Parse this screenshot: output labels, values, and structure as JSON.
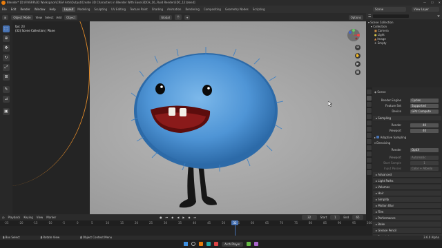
{
  "title_bar": {
    "text": "Blender* [D:\\FIVERR\\3D Workspace\\CREA Arts\\Output\\Create 3D Characters in Blender With Ease\\3DCH_16_Fluid Render\\3DC_12.blend]"
  },
  "menu": {
    "items": [
      "File",
      "Edit",
      "Render",
      "Window",
      "Help"
    ],
    "workspaces": [
      "Layout",
      "Modeling",
      "Sculpting",
      "UV Editing",
      "Texture Paint",
      "Shading",
      "Animation",
      "Rendering",
      "Compositing",
      "Geometry Nodes",
      "Scripting"
    ],
    "active_workspace": "Layout",
    "scene": "Scene",
    "view_layer": "View Layer"
  },
  "viewport_header": {
    "mode": "Object Mode",
    "menus": [
      "View",
      "Select",
      "Add",
      "Object"
    ],
    "transform": "Global",
    "options": "Options"
  },
  "viewport_info": {
    "fps": "fps: 23",
    "collection": "(32) Scene Collection | Plane"
  },
  "outliner": {
    "root": "Scene Collection",
    "items": [
      {
        "name": "Collection"
      },
      {
        "name": "Camera"
      },
      {
        "name": "Light"
      },
      {
        "name": "Image"
      },
      {
        "name": "Empty"
      }
    ]
  },
  "properties": {
    "scene_name": "Scene",
    "render_engine_label": "Render Engine",
    "render_engine": "Cycles",
    "feature_set_label": "Feature Set",
    "feature_set": "Supported",
    "device_label": "Device",
    "device": "GPU Compute",
    "sampling_label": "Sampling",
    "render_label": "Render",
    "render_samples": "40",
    "viewport_label": "Viewport",
    "viewport_samples": "40",
    "adaptive_label": "Adaptive Sampling",
    "denoising_label": "Denoising",
    "denoise_render_label": "Render",
    "denoiser": "OptiX",
    "denoise_viewport_label": "Viewport",
    "viewport_denoiser": "Automatic",
    "start_sample_label": "Start Sample",
    "start_sample": "1",
    "input_passes_label": "Input Passes",
    "input_passes": "Color + Albedo",
    "sections": [
      "Advanced",
      "Light Paths",
      "Volumes",
      "Hair",
      "Simplify",
      "Motion Blur",
      "Film",
      "Performance",
      "Bake",
      "Grease Pencil",
      "Freestyle"
    ]
  },
  "timeline": {
    "menus": [
      "Playback",
      "Keying",
      "View",
      "Marker"
    ],
    "current_frame": "32",
    "start_label": "Start",
    "start": "1",
    "end_label": "End",
    "end": "65",
    "ruler": [
      "-25",
      "-20",
      "-15",
      "-10",
      "-5",
      "0",
      "5",
      "10",
      "15",
      "20",
      "25",
      "30",
      "35",
      "40",
      "45",
      "50",
      "55",
      "60",
      "65",
      "70",
      "75",
      "80",
      "85",
      "90",
      "95",
      "100"
    ]
  },
  "status_bar": {
    "select": "Box Select",
    "rotate": "Rotate View",
    "context": "Object Context Menu",
    "version": "3.6.0 Alpha"
  },
  "taskbar": {
    "active_app": "Arch Player"
  },
  "colors": {
    "accent": "#4772b3",
    "brand": "#e87d0d",
    "fur": "#4f95d6",
    "mouth": "#8a1a1a"
  }
}
